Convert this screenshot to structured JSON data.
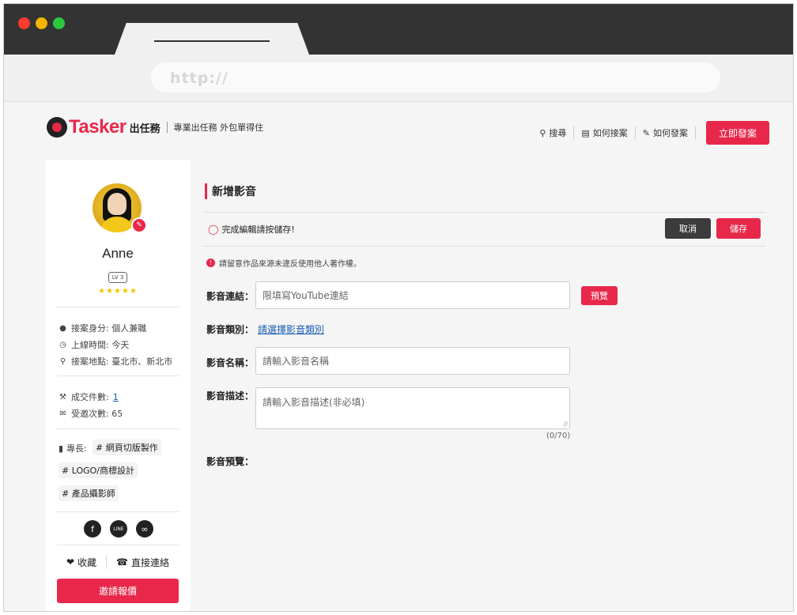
{
  "browser": {
    "url": "http://"
  },
  "header": {
    "logo_text": "Tasker",
    "logo_cn": "出任務",
    "slogan": "專業出任務 外包單得住",
    "nav": [
      {
        "label": "搜尋",
        "icon": "search-icon"
      },
      {
        "label": "如何接案",
        "icon": "document-icon"
      },
      {
        "label": "如何發案",
        "icon": "pencil-icon"
      }
    ],
    "post_button": "立即發案"
  },
  "profile": {
    "name": "Anne",
    "level": "LV 3",
    "stars": "★★★★★",
    "rating": 5,
    "identity": "接案身分: 個人兼職",
    "online": "上線時間: 今天",
    "location": "接案地點: 臺北市、新北市",
    "deals_label": "成交件數: ",
    "deals_value": "1",
    "invites": "受邀次數: 65",
    "skills_label": "專長:",
    "skills": [
      "# 網頁切版製作",
      "# LOGO/商標設計",
      "# 產品攝影師"
    ],
    "socials": [
      "facebook-icon",
      "line-icon",
      "link-icon"
    ],
    "favorite": "收藏",
    "contact": "直接連絡",
    "invite_button": "邀請報價"
  },
  "form": {
    "title": "新增影音",
    "tip": "完成編輯請按儲存!",
    "cancel": "取消",
    "save": "儲存",
    "notice": "請留意作品來源未違反使用他人著作權。",
    "link_label": "影音連結：",
    "link_placeholder": "限填寫YouTube連結",
    "preview_button": "預覽",
    "type_label": "影音類別：",
    "type_link": "請選擇影音類別",
    "name_label": "影音名稱：",
    "name_placeholder": "請輸入影音名稱",
    "desc_label": "影音描述：",
    "desc_placeholder": "請輸入影音描述(非必填)",
    "counter": "(0/70)",
    "preview_label": "影音預覽："
  },
  "colors": {
    "brand": "#e8284a",
    "dark": "#3c3c3c",
    "link": "#1a5fb4",
    "star": "#f5c400"
  }
}
